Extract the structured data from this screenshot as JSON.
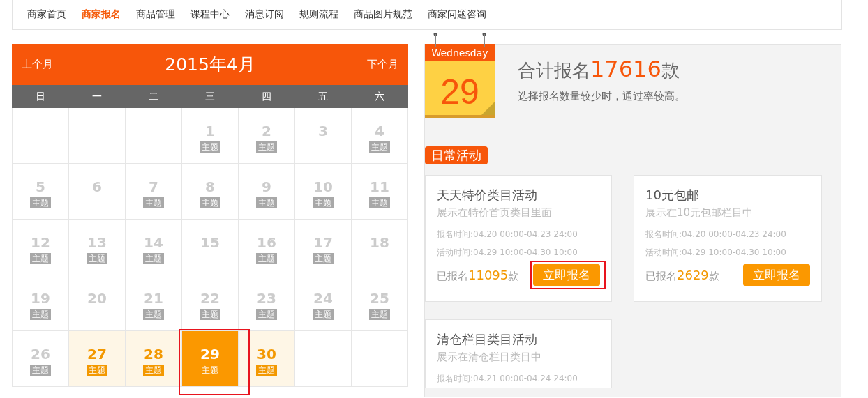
{
  "nav": [
    {
      "label": "商家首页",
      "selected": false
    },
    {
      "label": "商家报名",
      "selected": true
    },
    {
      "label": "商品管理",
      "selected": false
    },
    {
      "label": "课程中心",
      "selected": false
    },
    {
      "label": "消息订阅",
      "selected": false
    },
    {
      "label": "规则流程",
      "selected": false
    },
    {
      "label": "商品图片规范",
      "selected": false
    },
    {
      "label": "商家问题咨询",
      "selected": false
    }
  ],
  "calendar": {
    "prev": "上个月",
    "title": "2015年4月",
    "next": "下个月",
    "weekdays": [
      "日",
      "一",
      "二",
      "三",
      "四",
      "五",
      "六"
    ],
    "weeks": [
      [
        {
          "kind": "blank"
        },
        {
          "kind": "blank"
        },
        {
          "kind": "blank"
        },
        {
          "kind": "day",
          "day": "1",
          "tag": "主题",
          "selected": false,
          "upcoming": false,
          "highlighted": false
        },
        {
          "kind": "day",
          "day": "2",
          "tag": "主题",
          "selected": false,
          "upcoming": false,
          "highlighted": false
        },
        {
          "kind": "day",
          "day": "3",
          "selected": false,
          "upcoming": false,
          "highlighted": false
        },
        {
          "kind": "day",
          "day": "4",
          "tag": "主题",
          "selected": false,
          "upcoming": false,
          "highlighted": false
        }
      ],
      [
        {
          "kind": "day",
          "day": "5",
          "tag": "主题",
          "selected": false,
          "upcoming": false,
          "highlighted": false
        },
        {
          "kind": "day",
          "day": "6",
          "selected": false,
          "upcoming": false,
          "highlighted": false
        },
        {
          "kind": "day",
          "day": "7",
          "tag": "主题",
          "selected": false,
          "upcoming": false,
          "highlighted": false
        },
        {
          "kind": "day",
          "day": "8",
          "tag": "主题",
          "selected": false,
          "upcoming": false,
          "highlighted": false
        },
        {
          "kind": "day",
          "day": "9",
          "tag": "主题",
          "selected": false,
          "upcoming": false,
          "highlighted": false
        },
        {
          "kind": "day",
          "day": "10",
          "tag": "主题",
          "selected": false,
          "upcoming": false,
          "highlighted": false
        },
        {
          "kind": "day",
          "day": "11",
          "tag": "主题",
          "selected": false,
          "upcoming": false,
          "highlighted": false
        }
      ],
      [
        {
          "kind": "day",
          "day": "12",
          "tag": "主题",
          "selected": false,
          "upcoming": false,
          "highlighted": false
        },
        {
          "kind": "day",
          "day": "13",
          "tag": "主题",
          "selected": false,
          "upcoming": false,
          "highlighted": false
        },
        {
          "kind": "day",
          "day": "14",
          "tag": "主题",
          "selected": false,
          "upcoming": false,
          "highlighted": false
        },
        {
          "kind": "day",
          "day": "15",
          "selected": false,
          "upcoming": false,
          "highlighted": false
        },
        {
          "kind": "day",
          "day": "16",
          "tag": "主题",
          "selected": false,
          "upcoming": false,
          "highlighted": false
        },
        {
          "kind": "day",
          "day": "17",
          "tag": "主题",
          "selected": false,
          "upcoming": false,
          "highlighted": false
        },
        {
          "kind": "day",
          "day": "18",
          "selected": false,
          "upcoming": false,
          "highlighted": false
        }
      ],
      [
        {
          "kind": "day",
          "day": "19",
          "tag": "主题",
          "selected": false,
          "upcoming": false,
          "highlighted": false
        },
        {
          "kind": "day",
          "day": "20",
          "selected": false,
          "upcoming": false,
          "highlighted": false
        },
        {
          "kind": "day",
          "day": "21",
          "tag": "主题",
          "selected": false,
          "upcoming": false,
          "highlighted": false
        },
        {
          "kind": "day",
          "day": "22",
          "tag": "主题",
          "selected": false,
          "upcoming": false,
          "highlighted": false
        },
        {
          "kind": "day",
          "day": "23",
          "tag": "主题",
          "selected": false,
          "upcoming": false,
          "highlighted": false
        },
        {
          "kind": "day",
          "day": "24",
          "tag": "主题",
          "selected": false,
          "upcoming": false,
          "highlighted": false
        },
        {
          "kind": "day",
          "day": "25",
          "tag": "主题",
          "selected": false,
          "upcoming": false,
          "highlighted": false
        }
      ],
      [
        {
          "kind": "day",
          "day": "26",
          "tag": "主题",
          "selected": false,
          "upcoming": false,
          "highlighted": false
        },
        {
          "kind": "day",
          "day": "27",
          "tag": "主题",
          "selected": false,
          "upcoming": true,
          "highlighted": false
        },
        {
          "kind": "day",
          "day": "28",
          "tag": "主题",
          "selected": false,
          "upcoming": true,
          "highlighted": false
        },
        {
          "kind": "day",
          "day": "29",
          "tag": "主题",
          "selected": true,
          "highlighted": true
        },
        {
          "kind": "day",
          "day": "30",
          "tag": "主题",
          "selected": false,
          "upcoming": true,
          "highlighted": false
        },
        {
          "kind": "blank"
        },
        {
          "kind": "blank"
        }
      ]
    ]
  },
  "summary": {
    "weekday": "Wednesday",
    "date": "29",
    "total_prefix": "合计报名",
    "total": "17616",
    "total_suffix": "款",
    "hint": "选择报名数量较少时，通过率较高。"
  },
  "section_tag": "日常活动",
  "activities": [
    {
      "title": "天天特价类目活动",
      "desc": "展示在特价首页类目里面",
      "signup_time": "报名时间:04.20 00:00-04.23 24:00",
      "event_time": "活动时间:04.29 10:00-04.30 10:00",
      "count_prefix": "已报名",
      "count": "11095",
      "count_suffix": "款",
      "button": "立即报名",
      "highlighted": true
    },
    {
      "title": "10元包邮",
      "desc": "展示在10元包邮栏目中",
      "signup_time": "报名时间:04.20 00:00-04.23 24:00",
      "event_time": "活动时间:04.29 10:00-04.30 10:00",
      "count_prefix": "已报名",
      "count": "2629",
      "count_suffix": "款",
      "button": "立即报名",
      "highlighted": false
    },
    {
      "title": "清仓栏目类目活动",
      "desc": "展示在清仓栏目类目中",
      "signup_time": "报名时间:04.21 00:00-04.24 24:00"
    }
  ]
}
